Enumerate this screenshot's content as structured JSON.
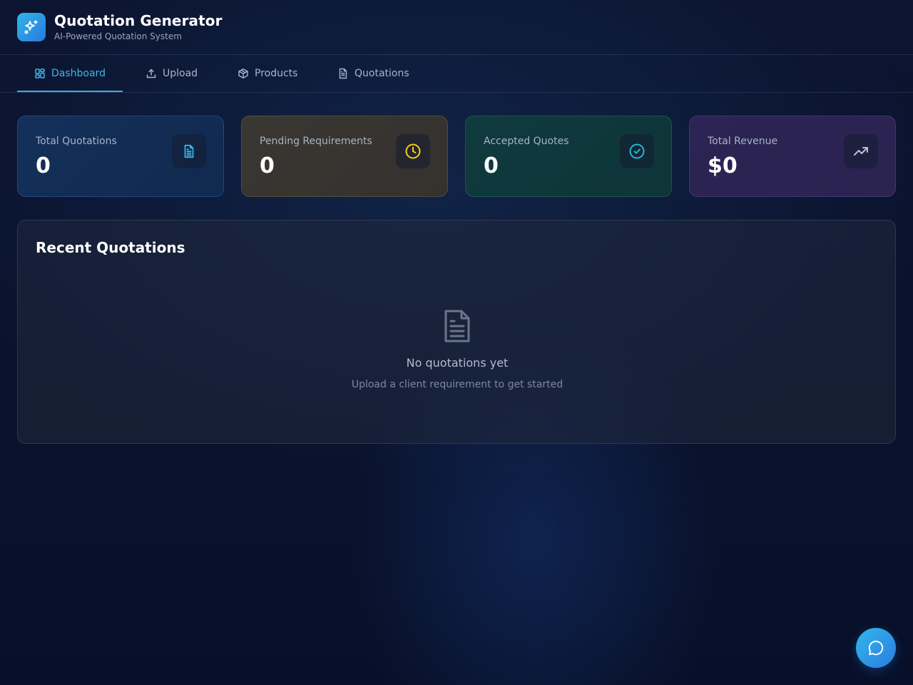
{
  "header": {
    "title": "Quotation Generator",
    "subtitle": "AI-Powered Quotation System",
    "logo_icon": "sparkles-icon"
  },
  "nav": {
    "tabs": [
      {
        "label": "Dashboard",
        "icon": "grid-icon",
        "active": true
      },
      {
        "label": "Upload",
        "icon": "upload-icon",
        "active": false
      },
      {
        "label": "Products",
        "icon": "box-icon",
        "active": false
      },
      {
        "label": "Quotations",
        "icon": "document-icon",
        "active": false
      }
    ]
  },
  "stats": [
    {
      "label": "Total Quotations",
      "value": "0",
      "icon": "document-icon",
      "accent": "#38bdf8"
    },
    {
      "label": "Pending Requirements",
      "value": "0",
      "icon": "clock-icon",
      "accent": "#facc15"
    },
    {
      "label": "Accepted Quotes",
      "value": "0",
      "icon": "check-circle-icon",
      "accent": "#22b8d8"
    },
    {
      "label": "Total Revenue",
      "value": "$0",
      "icon": "trending-up-icon",
      "accent": "#a5b4c8"
    }
  ],
  "recent": {
    "title": "Recent Quotations",
    "empty_title": "No quotations yet",
    "empty_subtitle": "Upload a client requirement to get started"
  },
  "chat": {
    "icon": "chat-icon"
  }
}
